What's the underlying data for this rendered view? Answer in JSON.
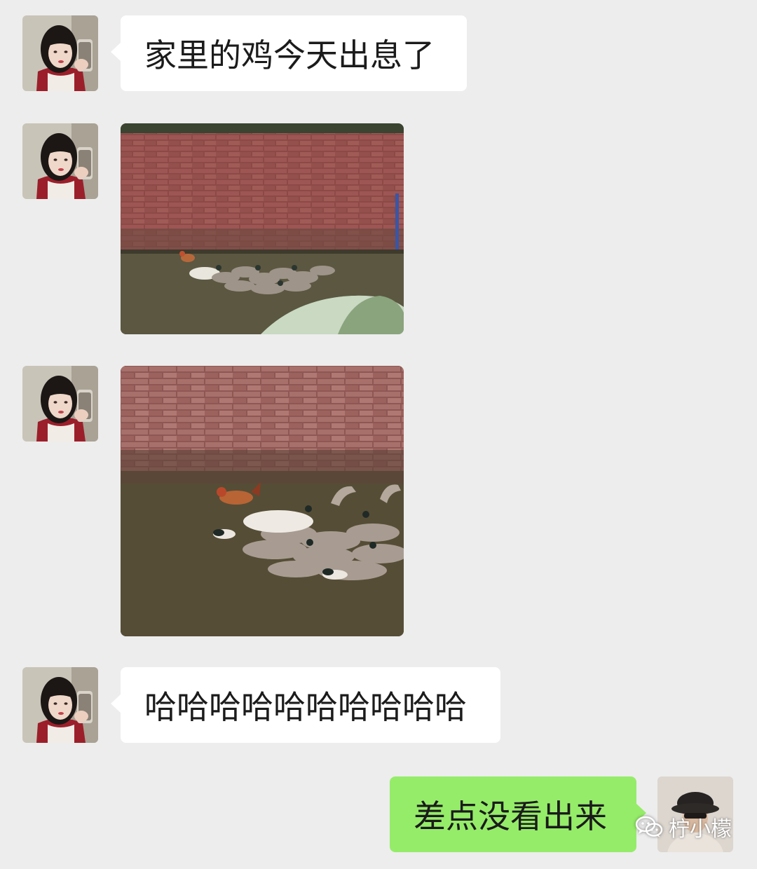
{
  "colors": {
    "background": "#ededed",
    "bubble_in": "#ffffff",
    "bubble_out": "#95ec69"
  },
  "messages": [
    {
      "side": "left",
      "type": "text",
      "text": "家里的鸡今天出息了"
    },
    {
      "side": "left",
      "type": "image",
      "image": "wall-pond-ducks-photo"
    },
    {
      "side": "left",
      "type": "image",
      "image": "chicken-among-ducks-photo"
    },
    {
      "side": "left",
      "type": "text",
      "text": "哈哈哈哈哈哈哈哈哈哈"
    },
    {
      "side": "right",
      "type": "text",
      "text": "差点没看出来"
    }
  ],
  "watermark": {
    "icon": "wechat-channel-icon",
    "label": "柠小檬"
  }
}
